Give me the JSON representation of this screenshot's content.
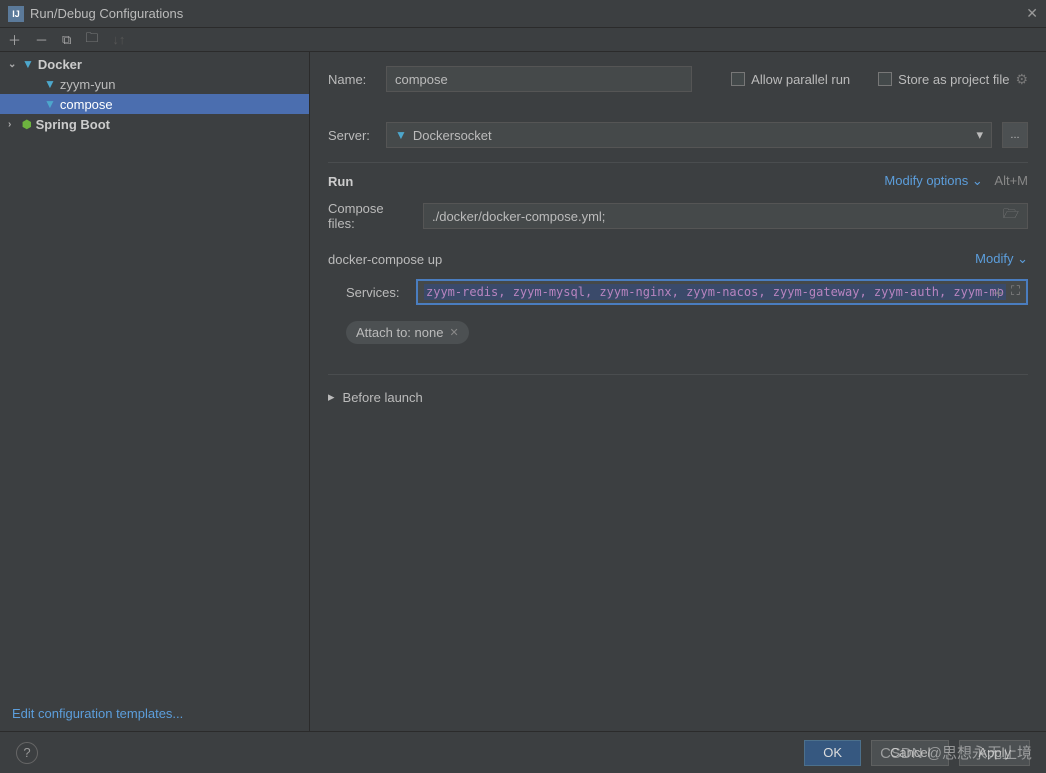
{
  "window": {
    "title": "Run/Debug Configurations"
  },
  "sidebar": {
    "items": [
      {
        "label": "Docker",
        "type": "group"
      },
      {
        "label": "zyym-yun",
        "type": "config"
      },
      {
        "label": "compose",
        "type": "config",
        "selected": true
      },
      {
        "label": "Spring Boot",
        "type": "group"
      }
    ],
    "edit_templates": "Edit configuration templates..."
  },
  "form": {
    "name_label": "Name:",
    "name_value": "compose",
    "allow_parallel": "Allow parallel run",
    "store_project": "Store as project file",
    "server_label": "Server:",
    "server_value": "Dockersocket",
    "more_btn": "...",
    "run_section": "Run",
    "modify_options": "Modify options",
    "modify_shortcut": "Alt+M",
    "compose_label": "Compose files:",
    "compose_value": "./docker/docker-compose.yml;",
    "compose_up": "docker-compose up",
    "modify": "Modify",
    "services_label": "Services:",
    "services_value": "zyym-redis, zyym-mysql, zyym-nginx, zyym-nacos, zyym-gateway, zyym-auth, zyym-mo",
    "attach_to": "Attach to: none",
    "before_launch": "Before launch"
  },
  "footer": {
    "ok": "OK",
    "cancel": "Cancel",
    "apply": "Apply"
  },
  "watermark": "CSDN @思想永无止境"
}
